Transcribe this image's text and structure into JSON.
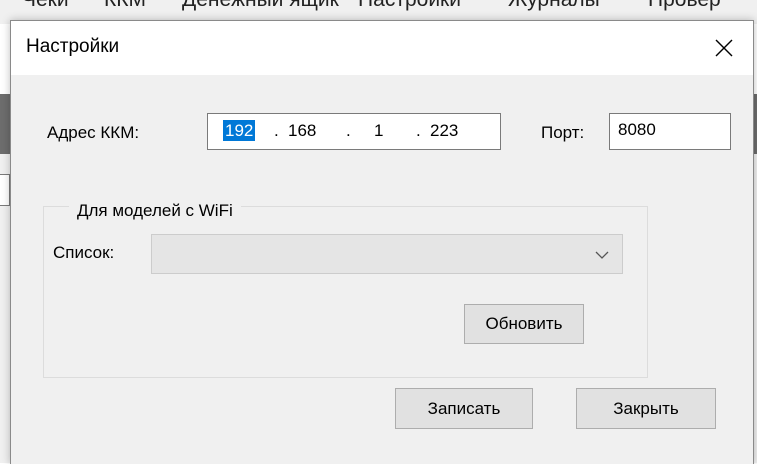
{
  "background_app": {
    "menu_items": [
      "Чеки",
      "ККМ",
      "Денежный ящик",
      "Настройки",
      "Журналы",
      "Провер"
    ]
  },
  "dialog": {
    "title": "Настройки",
    "address_label": "Адрес ККМ:",
    "ip": {
      "octet1": "192",
      "octet2": "168",
      "octet3": "1",
      "octet4": "223",
      "separator": "."
    },
    "port_label": "Порт:",
    "port_value": "8080",
    "wifi_group": {
      "legend": "Для моделей с WiFi",
      "list_label": "Список:",
      "list_value": "",
      "refresh_label": "Обновить"
    },
    "save_label": "Записать",
    "close_label": "Закрыть"
  }
}
